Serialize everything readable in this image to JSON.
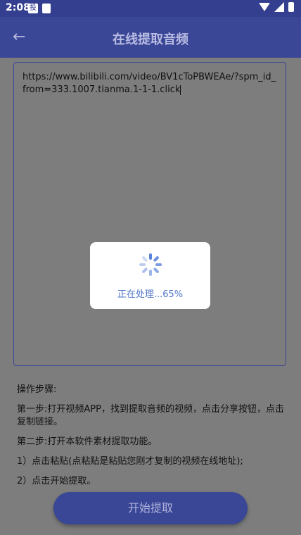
{
  "status_bar": {
    "time": "2:08",
    "notif_icon_label": "投"
  },
  "app_bar": {
    "title": "在线提取音频"
  },
  "url_input": {
    "value": "https://www.bilibili.com/video/BV1cToPBWEAe/?spm_id_from=333.1007.tianma.1-1-1.click"
  },
  "instructions": {
    "heading": "操作步骤:",
    "step1": "第一步:打开视频APP，找到提取音频的视频，点击分享按钮，点击复制链接。",
    "step2": "第二步:打开本软件素材提取功能。",
    "sub1": "1）点击粘贴(点粘贴是粘贴您刚才复制的视频在线地址);",
    "sub2": "2）点击开始提取。"
  },
  "start_button": {
    "label": "开始提取"
  },
  "progress_dialog": {
    "message": "正在处理...65%",
    "progress_percent": 65
  },
  "colors": {
    "primary": "#3a4696",
    "accent": "#5b83d9"
  }
}
